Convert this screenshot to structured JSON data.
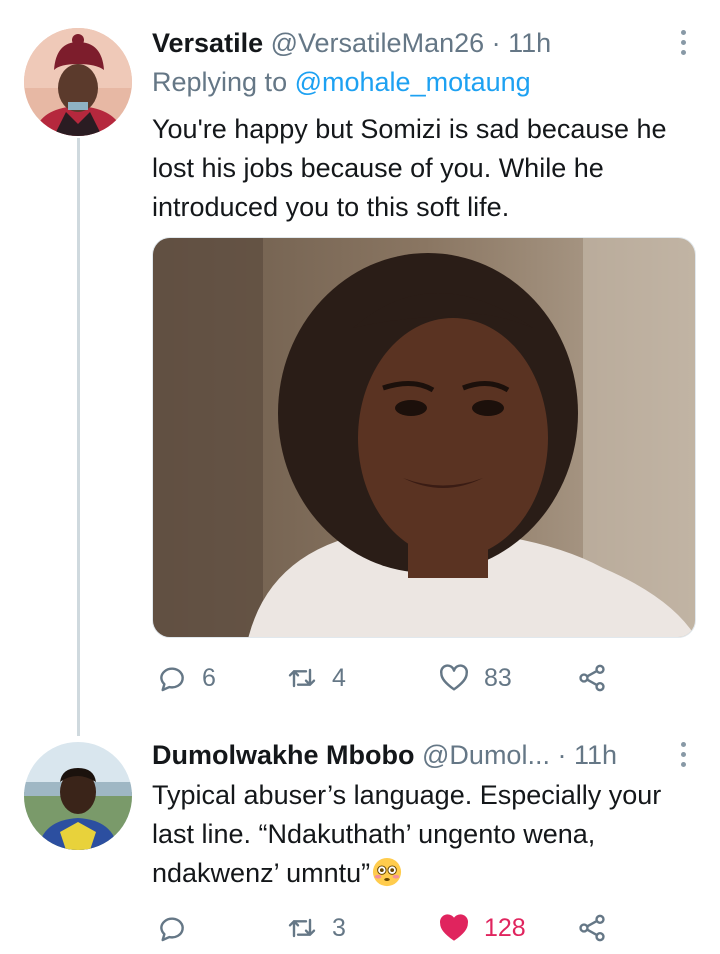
{
  "tweets": [
    {
      "display_name": "Versatile",
      "handle": "@VersatileMan26",
      "time": "11h",
      "replying_label": "Replying to",
      "replying_to": "@mohale_motaung",
      "text": "You're happy but Somizi is sad because he lost his jobs because of you. While he introduced you to this soft life.",
      "actions": {
        "replies": "6",
        "retweets": "4",
        "likes": "83"
      }
    },
    {
      "display_name": "Dumolwakhe Mbobo",
      "handle": "@Dumol...",
      "time": "11h",
      "text": "Typical abuser’s language. Especially your last line. “Ndakuthath’ ungento wena, ndakwenz’ umntu”",
      "actions": {
        "replies": "",
        "retweets": "3",
        "likes": "128"
      }
    }
  ],
  "icons": {
    "reply": "reply-icon",
    "retweet": "retweet-icon",
    "like": "heart-icon",
    "share": "share-icon",
    "more": "more-vertical-icon",
    "emoji": "flushed-face-emoji"
  },
  "colors": {
    "accent": "#1da1f2",
    "muted": "#657786",
    "like_active": "#e0245e"
  }
}
